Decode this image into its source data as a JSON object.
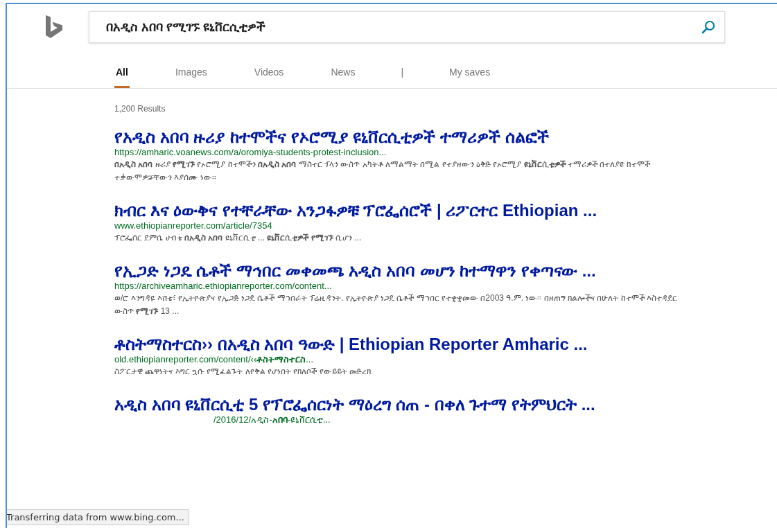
{
  "search": {
    "value": "በአዲስ አበባ የሚገኙ ዩኒቨርሲቲዎች"
  },
  "tabs": [
    {
      "label": "All",
      "selected": true,
      "kind": "tab"
    },
    {
      "label": "Images",
      "selected": false,
      "kind": "tab"
    },
    {
      "label": "Videos",
      "selected": false,
      "kind": "tab"
    },
    {
      "label": "News",
      "selected": false,
      "kind": "tab"
    },
    {
      "label": "|",
      "kind": "separator"
    },
    {
      "label": "My saves",
      "selected": false,
      "kind": "tab"
    }
  ],
  "result_count": "1,200 Results",
  "results": [
    {
      "title": "የአዲስ አበባ ዙሪያ ከተሞችና የኦሮሚያ ዩኒቨርሲቲዎች ተማሪዎች ሰልፎች",
      "url": "https://amharic.voanews.com/a/oromiya-students-protest-inclusion...",
      "snippet": "**በአዲስ አበባ** ዙሪያ **የሚገኙ** የኦሮሚያ ከተሞችን **በአዲስ አበባ** ማስተር ፕላን ውስጥ አካትቶ ለማልማት በሚል የተያዘውን ዕቅድ የኦሮሚያ **ዩኒቨርሲቲዎች** ተማሪዎች በተለያዩ ከተሞች ተቃውሞዎቻቸውን እያሰሙ ነው፡፡"
    },
    {
      "title": "ክብር እና ዕውቅና የተቸራቸው አንጋፋዎቹ ፕሮፌሰሮች | ሪፖርተር Ethiopian ...",
      "url": "www.ethiopianreporter.com/article/7354",
      "snippet": "ፕሮፌሰር ደምሴ ሀብቴ **በአዲስ አበባ** ዩኒቨርሲቲ ... **ዩኒቨርሲቲዎች የሚገኙ** ሲሆን ..."
    },
    {
      "title": "የኢጋድ ነጋዴ ሴቶች ማኅበር መቀመጫ አዲስ አበባ መሆን ከተማዋን የቀጣናው ...",
      "url": "https://archiveamharic.ethiopianreporter.com/content...",
      "snippet": "ወ/ሮ እንግዳዬ እሸቴ፣ የኢትዮጵያና የኢጋድ ነጋዴ ሴቶች ማኅበራት ፕሬዚዳንት. የኢትዮጵያ ነጋዴ ሴቶች ማኅበር የተቋቋመው በ2003 ዓ.ም. ነው፡፡ በዘጠኝ ክልሎችና በሁለት ከተሞች እስተዳደር ውስጥ **የሚገኙ** 13 ..."
    },
    {
      "title": "ቶስትማስተርስ›› በአዲስ አበባ ዓውድ | Ethiopian Reporter Amharic ...",
      "url": "old.ethiopianreporter.com/content/‹‹**ቶስትማስተርስ**...",
      "snippet": "ስፖርታዊ ጨዋነትና እግር ኳሱ የሚፈልጉት ለየቅል የሆነበት የክለቦች የውይይት መድረክ"
    },
    {
      "title": "አዲስ አበባ ዩኒቨርሲቲ 5 የፕሮፌሰርነት ማዕረግ ሰጠ - በቀለ ጉተማ የትምህርት ...",
      "url": "/2016/12/አዲስ-**አበባ**-ዩኒቨርሲቲ..."
    }
  ],
  "status_bar": "Transferring data from www.bing.com..."
}
